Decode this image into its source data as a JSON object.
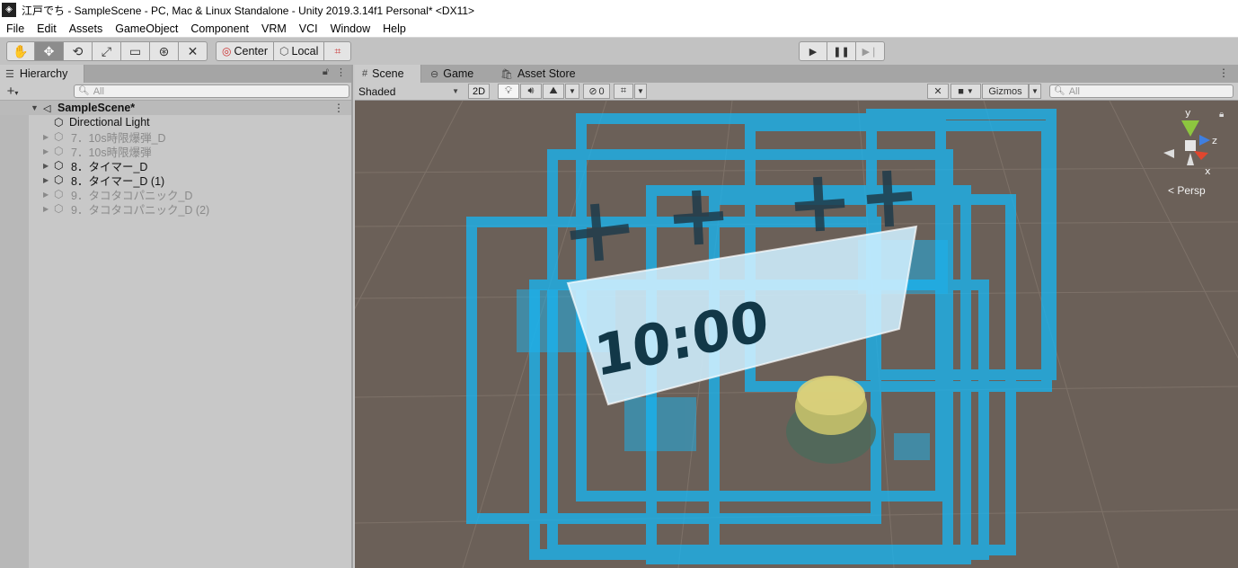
{
  "window": {
    "app_icon": "unity-logo-icon",
    "title": "江戸でち - SampleScene - PC, Mac & Linux Standalone - Unity 2019.3.14f1 Personal* <DX11>"
  },
  "menu": [
    "File",
    "Edit",
    "Assets",
    "GameObject",
    "Component",
    "VRM",
    "VCI",
    "Window",
    "Help"
  ],
  "toolbar": {
    "tools": [
      {
        "name": "hand-tool-icon",
        "glyph": "✋"
      },
      {
        "name": "move-tool-icon",
        "glyph": "✥"
      },
      {
        "name": "rotate-tool-icon",
        "glyph": "⟲"
      },
      {
        "name": "scale-tool-icon",
        "glyph": "⤢"
      },
      {
        "name": "rect-tool-icon",
        "glyph": "▭"
      },
      {
        "name": "transform-tool-icon",
        "glyph": "⊛"
      },
      {
        "name": "custom-tool-icon",
        "glyph": "✕"
      }
    ],
    "active_tool_index": 1,
    "pivot_mode": "Center",
    "pivot_rotation": "Local",
    "grid_snap_icon": "grid-snap-icon"
  },
  "hierarchy": {
    "tab_label": "Hierarchy",
    "search_placeholder": "All",
    "scene_name": "SampleScene*",
    "items": [
      {
        "label": "Directional Light",
        "has_children": false,
        "dim": false
      },
      {
        "label": "7．10s時限爆弾_D",
        "has_children": true,
        "dim": true
      },
      {
        "label": "7．10s時限爆弾",
        "has_children": true,
        "dim": true
      },
      {
        "label": "8．タイマー_D",
        "has_children": true,
        "dim": false
      },
      {
        "label": "8．タイマー_D (1)",
        "has_children": true,
        "dim": false
      },
      {
        "label": "9．タコタコパニック_D",
        "has_children": true,
        "dim": true
      },
      {
        "label": "9．タコタコパニック_D (2)",
        "has_children": true,
        "dim": true
      }
    ]
  },
  "scene": {
    "tabs": [
      {
        "label": "Scene",
        "icon": "grid-icon"
      },
      {
        "label": "Game",
        "icon": "gamepad-icon"
      },
      {
        "label": "Asset Store",
        "icon": "shopping-bag-icon"
      }
    ],
    "draw_mode": "Shaded",
    "mode_2d": "2D",
    "hidden_count": "0",
    "gizmos_label": "Gizmos",
    "search_placeholder": "All",
    "projection_label": "Persp",
    "timer_text": "10:00",
    "gizmo_axes": {
      "y": "y",
      "z": "z",
      "x": "x"
    },
    "colors": {
      "viewport_bg": "#6b6058",
      "cyan_frames": "#19b4f0",
      "axis_x": "#e0462e",
      "axis_y": "#8dc63f",
      "axis_z": "#3f7fe0"
    }
  }
}
